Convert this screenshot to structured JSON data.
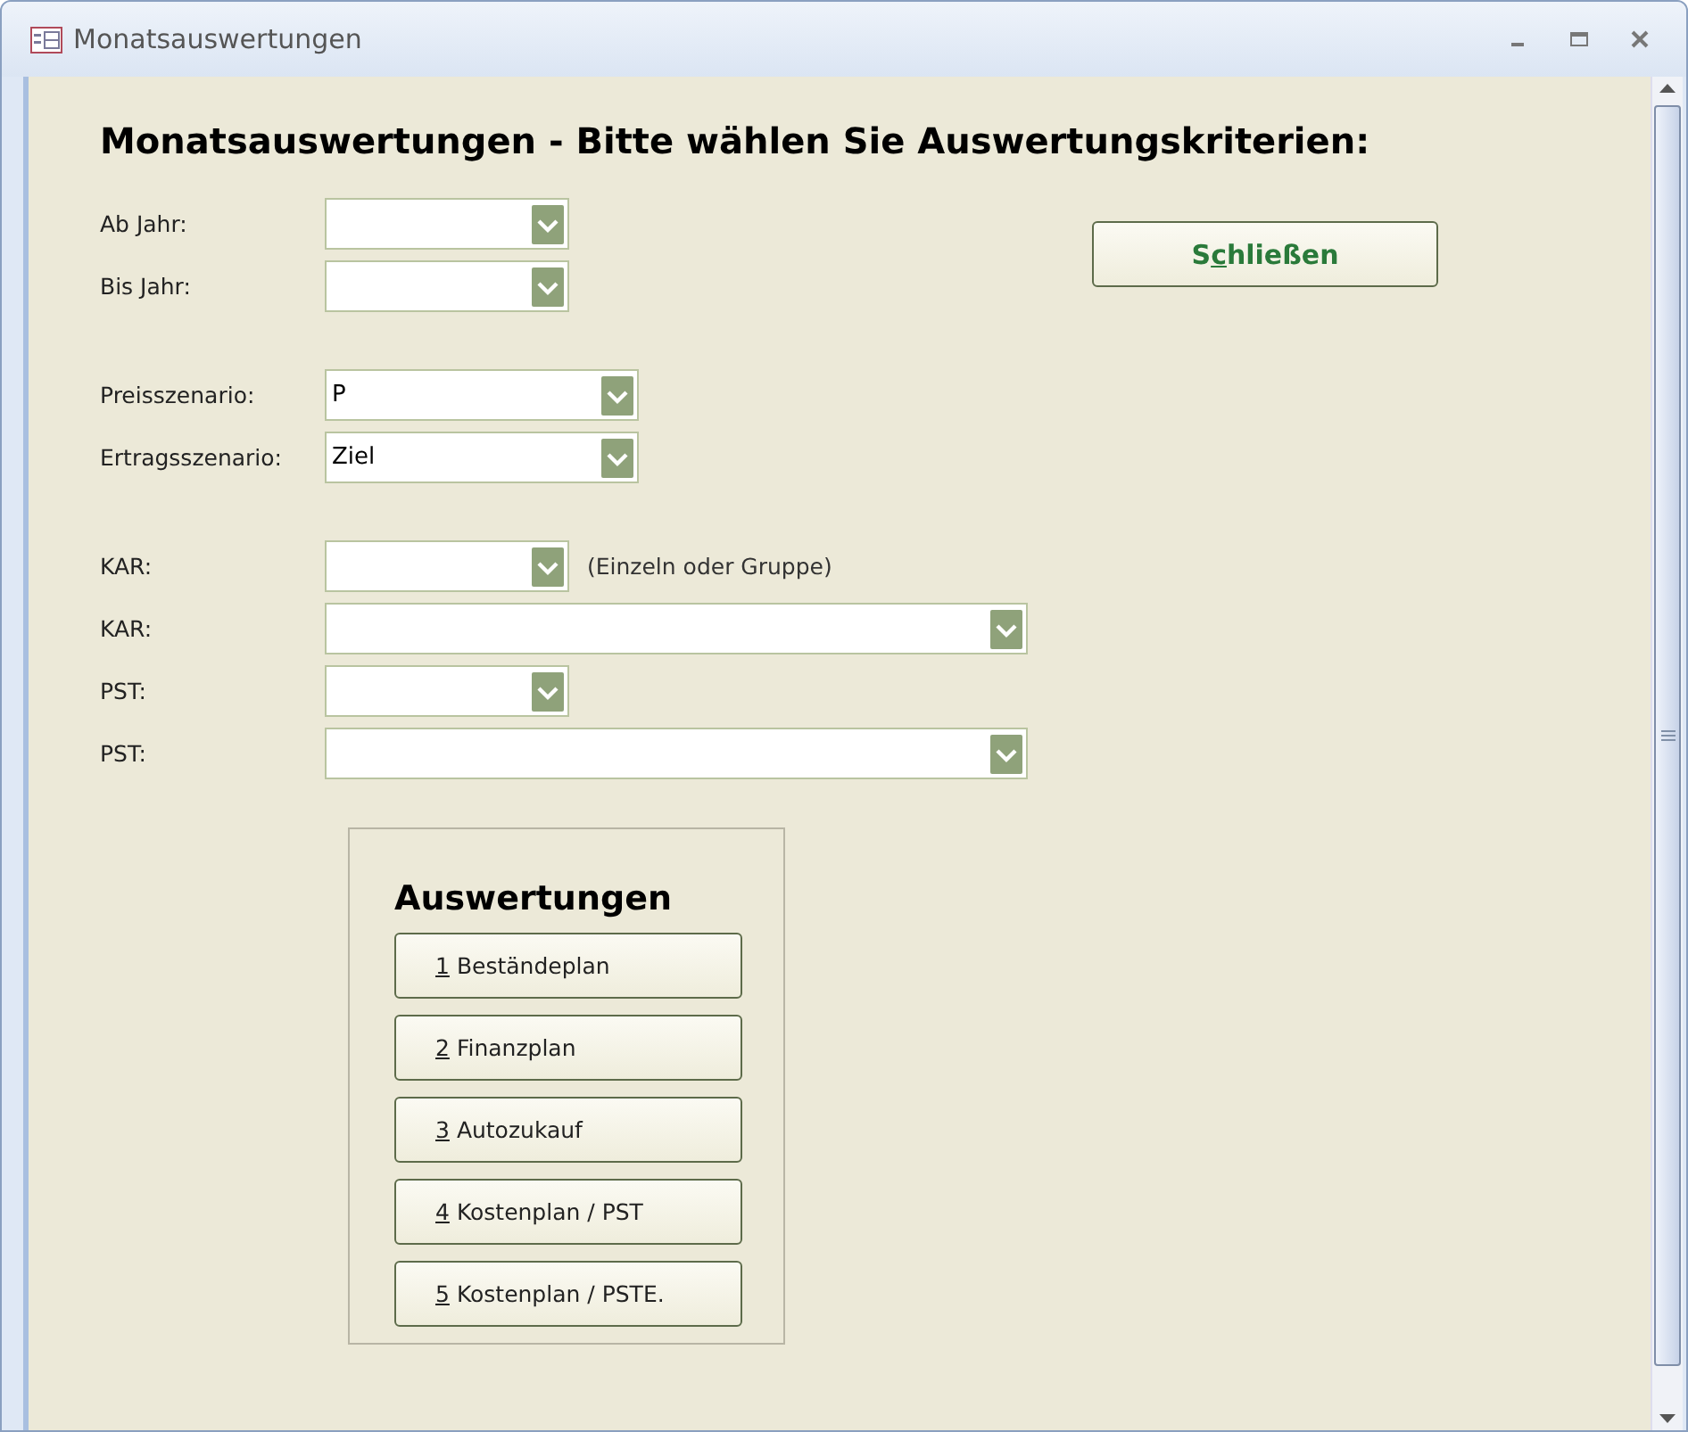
{
  "window": {
    "title": "Monatsauswertungen"
  },
  "heading": "Monatsauswertungen - Bitte wählen Sie Auswertungskriterien:",
  "close_button": {
    "prefix": "S",
    "access_key": "c",
    "rest": "hließen"
  },
  "field_groups": [
    [
      {
        "label": "Ab Jahr:"
      },
      {
        "label": "Bis Jahr:"
      }
    ],
    [
      {
        "label": "Preisszenario:",
        "value": "P"
      },
      {
        "label": "Ertragsszenario:",
        "value": "Ziel"
      }
    ],
    [
      {
        "label": "KAR:",
        "note": "(Einzeln oder Gruppe)"
      },
      {
        "label": "KAR:"
      },
      {
        "label": "PST:"
      },
      {
        "label": "PST:"
      }
    ]
  ],
  "reports": {
    "title": "Auswertungen",
    "buttons": [
      {
        "access_key": "1",
        "rest": "Beständeplan"
      },
      {
        "access_key": "2",
        "rest": "Finanzplan"
      },
      {
        "access_key": "3",
        "rest": "Autozukauf"
      },
      {
        "access_key": "4",
        "rest": "Kostenplan / PST"
      },
      {
        "access_key": "5",
        "rest": "Kostenplan / PSTE."
      }
    ]
  }
}
